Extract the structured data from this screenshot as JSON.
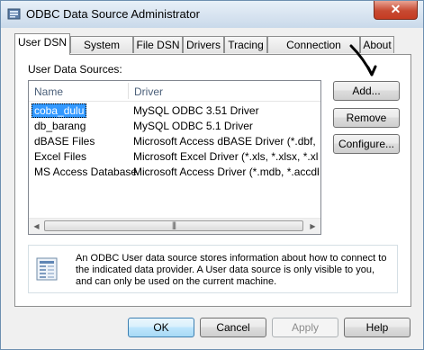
{
  "window": {
    "title": "ODBC Data Source Administrator",
    "close_glyph": "✕"
  },
  "tabs": [
    {
      "label": "User DSN",
      "active": true
    },
    {
      "label": "System DSN",
      "active": false
    },
    {
      "label": "File DSN",
      "active": false
    },
    {
      "label": "Drivers",
      "active": false
    },
    {
      "label": "Tracing",
      "active": false
    },
    {
      "label": "Connection Pooling",
      "active": false
    },
    {
      "label": "About",
      "active": false
    }
  ],
  "user_dsn": {
    "label": "User Data Sources:",
    "columns": [
      "Name",
      "Driver"
    ],
    "rows": [
      {
        "name": "coba_dulu",
        "driver": "MySQL ODBC 3.51 Driver",
        "selected": true
      },
      {
        "name": "db_barang",
        "driver": "MySQL ODBC 5.1 Driver",
        "selected": false
      },
      {
        "name": "dBASE Files",
        "driver": "Microsoft Access dBASE Driver (*.dbf, *.ndx",
        "selected": false
      },
      {
        "name": "Excel Files",
        "driver": "Microsoft Excel Driver (*.xls, *.xlsx, *.xlsm, *.x",
        "selected": false
      },
      {
        "name": "MS Access Database",
        "driver": "Microsoft Access Driver (*.mdb, *.accdb)",
        "selected": false
      }
    ],
    "buttons": {
      "add": "Add...",
      "remove": "Remove",
      "configure": "Configure..."
    },
    "info_text": "An ODBC User data source stores information about how to connect to the indicated data provider.   A User data source is only visible to you, and can only be used on the current machine."
  },
  "footer_buttons": {
    "ok": "OK",
    "cancel": "Cancel",
    "apply": "Apply",
    "help": "Help"
  },
  "icons": {
    "app": "odbc-admin-icon",
    "info": "database-list-icon",
    "annotation": "hand-drawn-arrow"
  },
  "colors": {
    "selection": "#3399ff",
    "close": "#c74a32"
  }
}
